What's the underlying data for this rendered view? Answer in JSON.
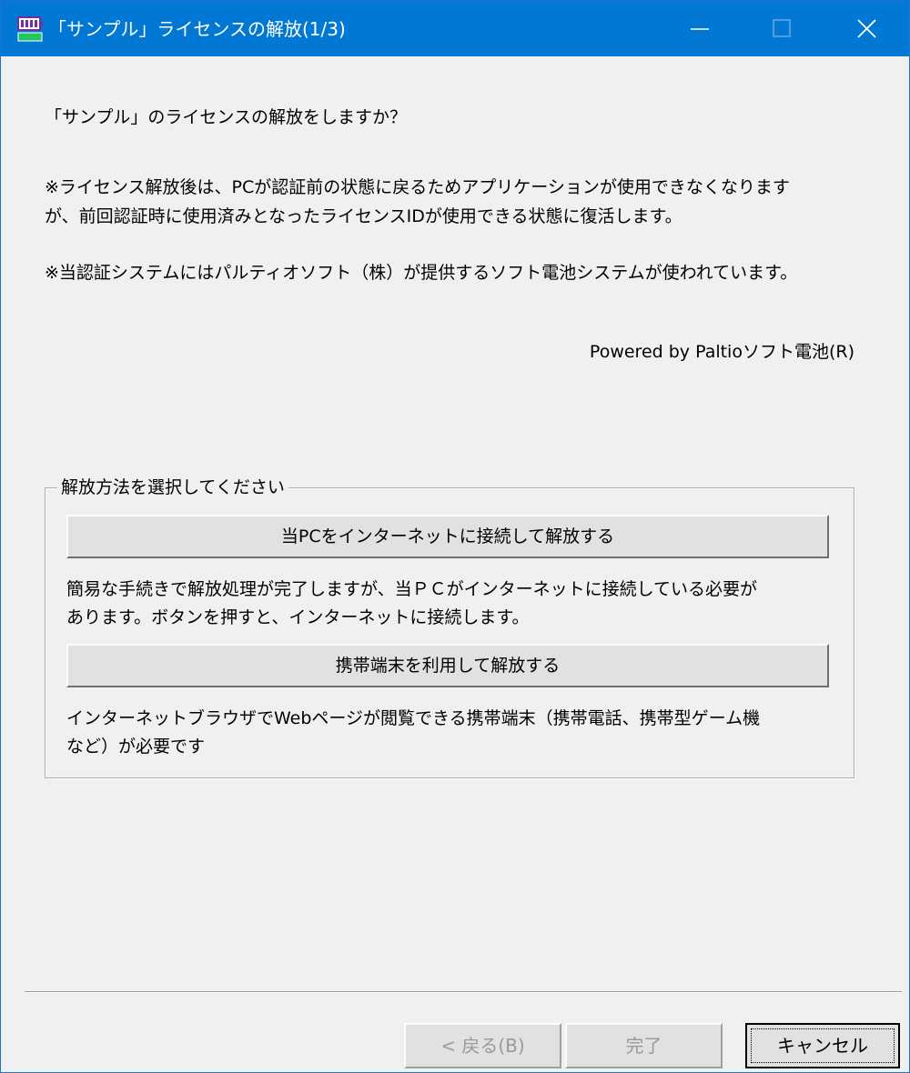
{
  "window": {
    "title": "「サンプル」ライセンスの解放(1/3)",
    "icon": "app-license-icon",
    "controls": {
      "minimize_icon": "minimize-icon",
      "maximize_icon": "maximize-icon",
      "close_icon": "close-icon"
    }
  },
  "content": {
    "question": "「サンプル」のライセンスの解放をしますか？",
    "note1_line1": "※ライセンス解放後は、PCが認証前の状態に戻るためアプリケーションが使用できなくなります",
    "note1_line2": "が、前回認証時に使用済みとなったライセンスIDが使用できる状態に復活します。",
    "note2": "※当認証システムにはパルティオソフト（株）が提供するソフト電池システムが使われています。",
    "powered_by": "Powered by Paltioソフト電池(R)"
  },
  "method_group": {
    "legend": "解放方法を選択してください",
    "internet_button": "当PCをインターネットに接続して解放する",
    "internet_desc_line1": "簡易な手続きで解放処理が完了しますが、当ＰＣがインターネットに接続している必要が",
    "internet_desc_line2": "あります。ボタンを押すと、インターネットに接続します。",
    "mobile_button": "携帯端末を利用して解放する",
    "mobile_desc_line1": "インターネットブラウザでWebページが閲覧できる携帯端末（携帯電話、携帯型ゲーム機",
    "mobile_desc_line2": "など）が必要です"
  },
  "footer": {
    "back_label": "< 戻る(B)",
    "finish_label": "完了",
    "cancel_label": "キャンセル"
  },
  "colors": {
    "titlebar": "#0078d4",
    "background": "#f0f0f0",
    "button_face": "#e1e1e1",
    "disabled_text": "#9a9a9a"
  }
}
